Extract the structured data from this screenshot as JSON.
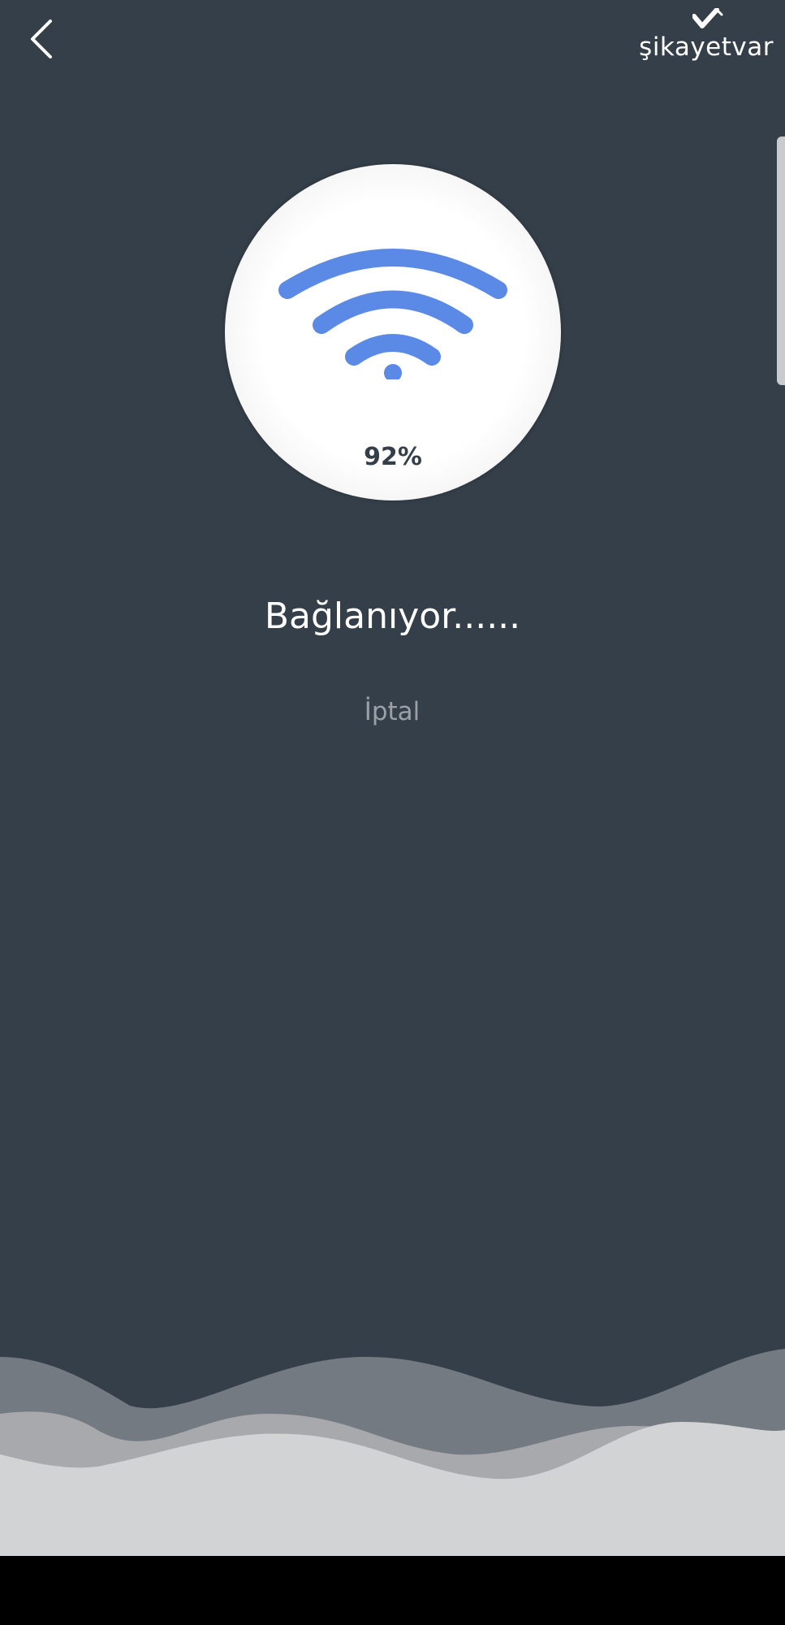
{
  "watermark": {
    "text": "şikayetvar"
  },
  "connection": {
    "percent_label": "92%",
    "percent_value": 92,
    "status": "Bağlanıyor......",
    "cancel_label": "İptal"
  },
  "icons": {
    "back": "chevron-left-icon",
    "wifi": "wifi-icon"
  },
  "colors": {
    "background": "#353f49",
    "wifi_blue": "#5b8ae6",
    "circle_white": "#ffffff",
    "cancel_gray": "#9aa0a6",
    "wave_light": "#d2d3d5",
    "wave_mid": "#a7a9ad",
    "wave_dark": "#747a81"
  }
}
